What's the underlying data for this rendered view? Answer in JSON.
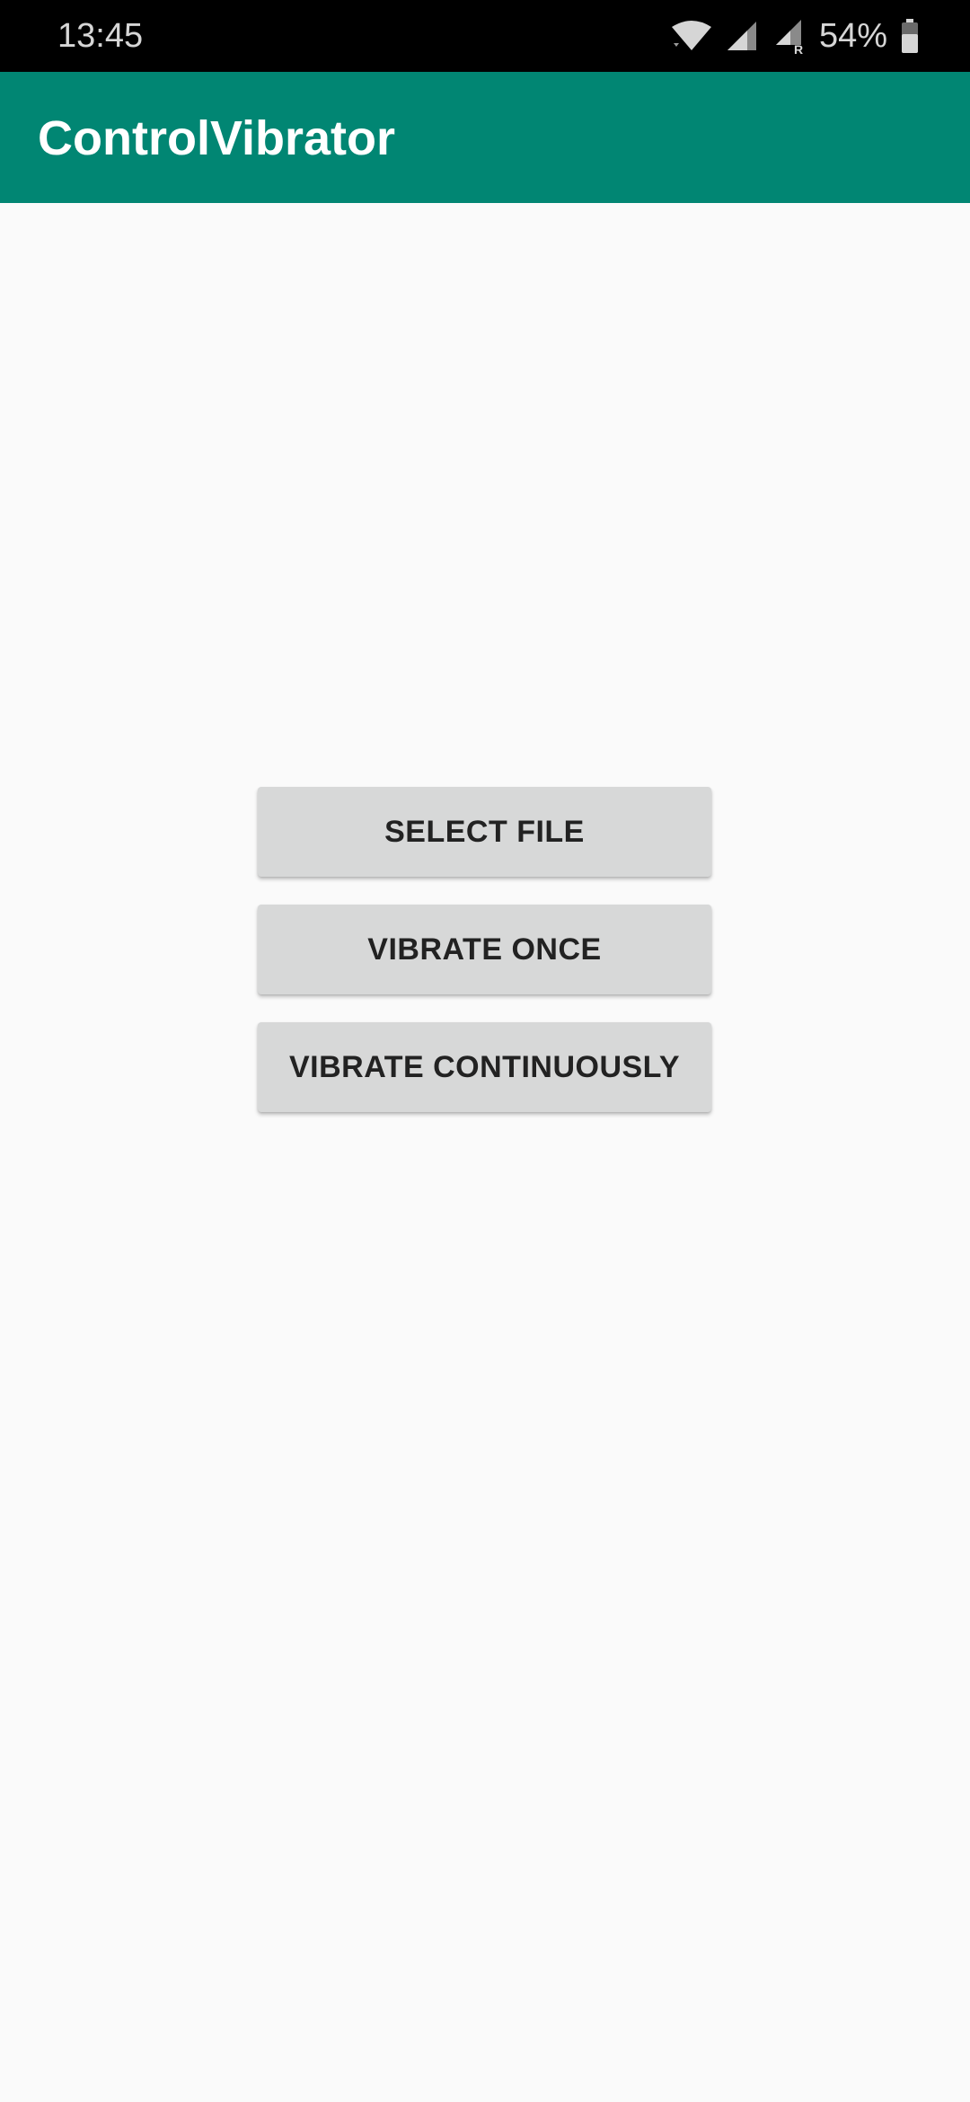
{
  "status_bar": {
    "time": "13:45",
    "battery": "54%",
    "icons": [
      "wifi-icon",
      "signal-icon",
      "signal-roaming-icon",
      "battery-icon"
    ]
  },
  "app_bar": {
    "title": "ControlVibrator",
    "color": "#018673"
  },
  "buttons": [
    {
      "label": "SELECT FILE"
    },
    {
      "label": "VIBRATE ONCE"
    },
    {
      "label": "VIBRATE CONTINUOUSLY"
    }
  ],
  "colors": {
    "background": "#fafafa",
    "button": "#d7d8d8",
    "button_text": "#222222",
    "status_bar": "#000000"
  }
}
